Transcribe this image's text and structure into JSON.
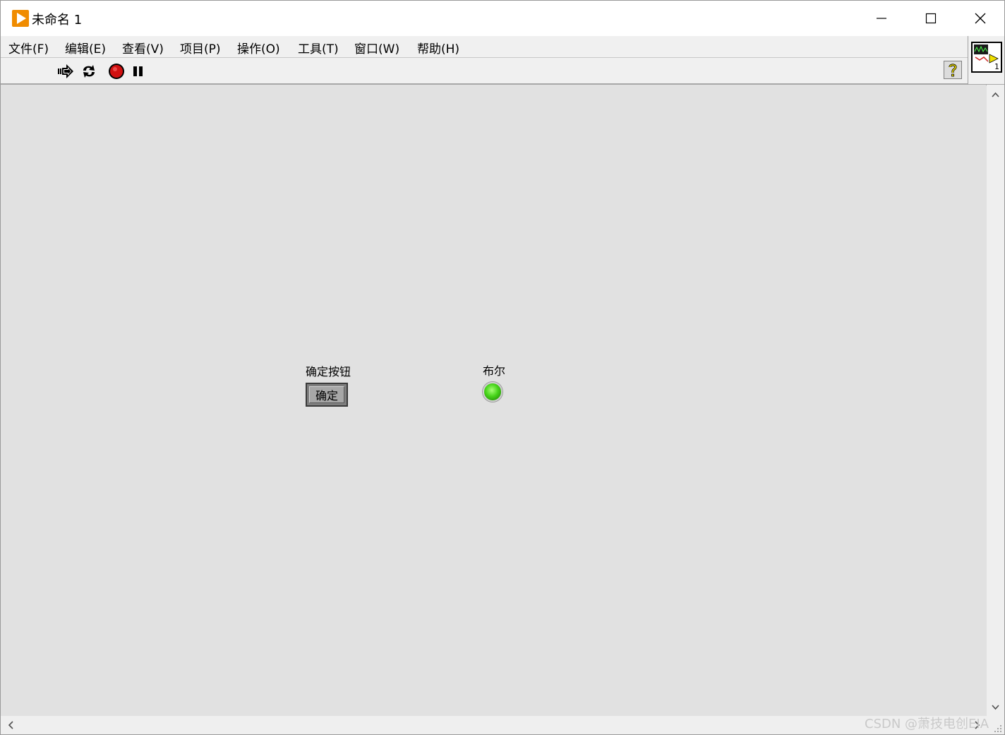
{
  "window": {
    "title": "未命名 1",
    "app_icon": "labview-run-icon",
    "controls": [
      "minimize-icon",
      "maximize-icon",
      "close-icon"
    ]
  },
  "menu": {
    "items": [
      {
        "label": "文件(F)"
      },
      {
        "label": "编辑(E)"
      },
      {
        "label": "查看(V)"
      },
      {
        "label": "项目(P)"
      },
      {
        "label": "操作(O)"
      },
      {
        "label": "工具(T)"
      },
      {
        "label": "窗口(W)"
      },
      {
        "label": "帮助(H)"
      }
    ]
  },
  "toolbar": {
    "buttons": [
      "run-icon",
      "run-continuously-icon",
      "abort-execution-icon",
      "pause-icon"
    ],
    "help": "context-help-icon"
  },
  "vi_icon": {
    "number": "1"
  },
  "front_panel": {
    "button_control": {
      "label": "确定按钮",
      "text": "确定"
    },
    "boolean_indicator": {
      "label": "布尔",
      "state": "on",
      "color": "#47d41a"
    }
  },
  "watermark": "CSDN @萧技电创EIA",
  "colors": {
    "panel_bg": "#e1e1e1",
    "app_icon": "#f08c00",
    "abort_red": "#d01010"
  }
}
